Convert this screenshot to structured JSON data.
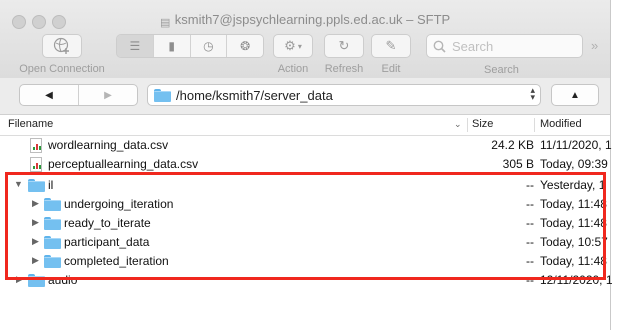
{
  "window": {
    "title": "ksmith7@jspsychlearning.ppls.ed.ac.uk – SFTP"
  },
  "toolbar": {
    "open_connection_label": "Open Connection",
    "action_label": "Action",
    "refresh_label": "Refresh",
    "edit_label": "Edit",
    "search_label": "Search",
    "search_placeholder": "Search"
  },
  "nav": {
    "path": "/home/ksmith7/server_data"
  },
  "columns": {
    "filename": "Filename",
    "size": "Size",
    "modified": "Modified"
  },
  "files": [
    {
      "name": "wordlearning_data.csv",
      "size": "24.2 KB",
      "modified": "11/11/2020, 1"
    },
    {
      "name": "perceptuallearning_data.csv",
      "size": "305 B",
      "modified": "Today, 09:39"
    },
    {
      "name": "il",
      "size": "--",
      "modified": "Yesterday, 1"
    },
    {
      "name": "undergoing_iteration",
      "size": "--",
      "modified": "Today, 11:48"
    },
    {
      "name": "ready_to_iterate",
      "size": "--",
      "modified": "Today, 11:48"
    },
    {
      "name": "participant_data",
      "size": "--",
      "modified": "Today, 10:57"
    },
    {
      "name": "completed_iteration",
      "size": "--",
      "modified": "Today, 11:48"
    },
    {
      "name": "audio",
      "size": "--",
      "modified": "12/11/2020, 1"
    }
  ],
  "colors": {
    "highlight": "#f0281e",
    "folder": "#74c0f0"
  }
}
